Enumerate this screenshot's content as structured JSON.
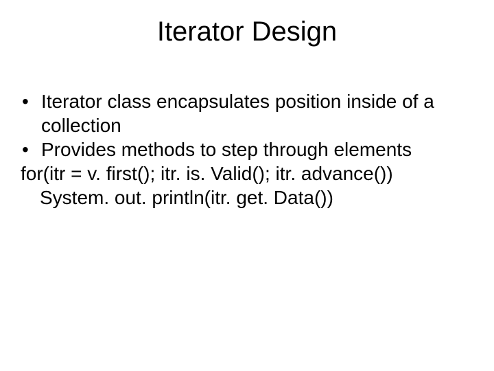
{
  "slide": {
    "title": "Iterator Design",
    "bullets": [
      "Iterator class encapsulates position inside of a collection",
      "Provides methods to step through elements"
    ],
    "code_lines": [
      "for(itr = v. first(); itr. is. Valid(); itr. advance())",
      "System. out. println(itr. get. Data())"
    ]
  }
}
